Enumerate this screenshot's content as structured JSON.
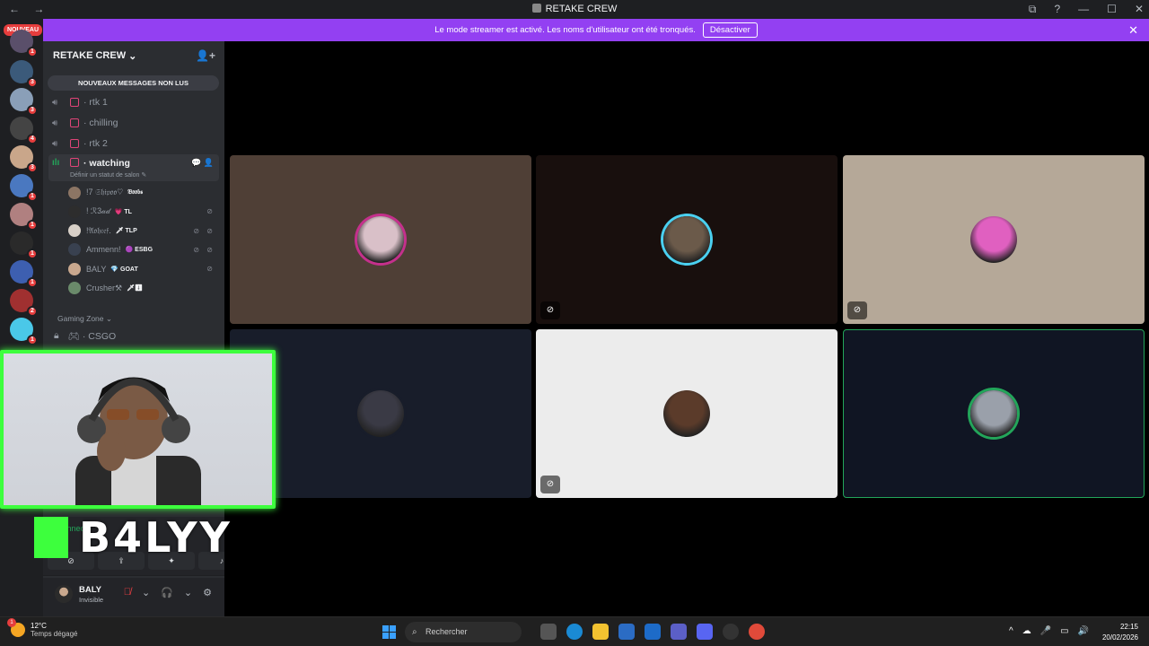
{
  "window": {
    "title": "RETAKE CREW",
    "nav_arrows": "← →",
    "controls": [
      "⧉",
      "?",
      "—",
      "☐",
      "✕"
    ]
  },
  "banner": {
    "text": "Le mode streamer est activé. Les noms d'utilisateur ont été tronqués.",
    "button_label": "Désactiver",
    "close": "✕",
    "color": "#9340f2"
  },
  "guilds": {
    "new_pill": "NOUVEAU",
    "items": [
      {
        "badge": "1",
        "color": "#5a4f6a"
      },
      {
        "badge": "3",
        "color": "#3b5a7a"
      },
      {
        "badge": "3",
        "color": "#8a9fb8"
      },
      {
        "badge": "4",
        "color": "#444"
      },
      {
        "badge": "3",
        "color": "#c9a68a"
      },
      {
        "badge": "1",
        "color": "#4a78c0"
      },
      {
        "badge": "1",
        "color": "#b08080"
      },
      {
        "badge": "1",
        "color": "#2a2a2a"
      },
      {
        "badge": "1",
        "color": "#3d5fb0"
      },
      {
        "badge": "2",
        "color": "#a03030"
      },
      {
        "badge": "1",
        "color": "#4ac8e8"
      }
    ]
  },
  "server": {
    "name": "RETAKE CREW",
    "chevron": "⌄",
    "invite_icon": "👤+",
    "unread_label": "NOUVEAUX MESSAGES NON LUS",
    "channels": [
      {
        "name": "rtk 1"
      },
      {
        "name": "chilling"
      },
      {
        "name": "rtk 2"
      }
    ],
    "active_channel": {
      "name": "watching",
      "status": "Définir un statut de salon ✎",
      "actions": "💬 👤"
    },
    "voice_users": [
      {
        "name": "!7 𝔖𝔥𝔦𝔭𝔬𝔬♡",
        "tag": "𝔅𝔬𝔬𝔟𝔰",
        "state": "",
        "color": "#8c7564"
      },
      {
        "name": "! ℛ3𝒶𝒹",
        "tag": "💗 TL",
        "state": "⊘",
        "color": "#2d2d2d"
      },
      {
        "name": "!𝔄𝔬𝔥𝔠𝔢𝔣.",
        "tag": "🗡 TLP",
        "state": "⊘ ⊘",
        "color": "#d8d0c8"
      },
      {
        "name": "Ammenn!",
        "tag": "🟣 ESBG",
        "state": "⊘ ⊘",
        "color": "#394150"
      },
      {
        "name": "BALY",
        "tag": "💎 GOAT",
        "state": "⊘",
        "color": "#c9a88e"
      },
      {
        "name": "Crusher⚒",
        "tag": "🗡⬇",
        "state": "",
        "color": "#6a8a6a"
      }
    ],
    "category": "Gaming Zone ⌄",
    "locked_channel": "CSGO"
  },
  "voice_panel": {
    "connected": "Connecté"
  },
  "user": {
    "name": "BALY",
    "status": "Invisible",
    "controls": {
      "mic": "🎙̸",
      "mic_arrow": "⌄",
      "headset": "🎧",
      "headset_arrow": "⌄",
      "settings": "⚙"
    }
  },
  "tiles": [
    {
      "bg": "#4f3f36",
      "avatar": "#d9c0c8",
      "ring": "#c4308c",
      "muted": false
    },
    {
      "bg": "#180f0d",
      "avatar": "#6b5a4a",
      "ring": "#4ad0f0",
      "muted": true
    },
    {
      "bg": "#b5a898",
      "avatar": "#e060c0",
      "ring": "#b5a898",
      "muted": true
    },
    {
      "bg": "#181d2a",
      "avatar": "#3a3a45",
      "ring": "#181d2a",
      "muted": false
    },
    {
      "bg": "#ececec",
      "avatar": "#5b3b2a",
      "ring": "#ececec",
      "muted": true
    },
    {
      "bg": "#101523",
      "avatar": "#9aa0aa",
      "ring": "#23a55a",
      "muted": false
    }
  ],
  "overlay": {
    "name": "B4LYY"
  },
  "taskbar": {
    "temp": "12°C",
    "weather": "Temps dégagé",
    "weather_badge": "1",
    "search_placeholder": "Rechercher",
    "search_icon": "⌕",
    "tray": [
      "^",
      "☁",
      "🎤",
      "▭",
      "🔊"
    ],
    "time": "22:15",
    "date": "20/02/2026"
  }
}
